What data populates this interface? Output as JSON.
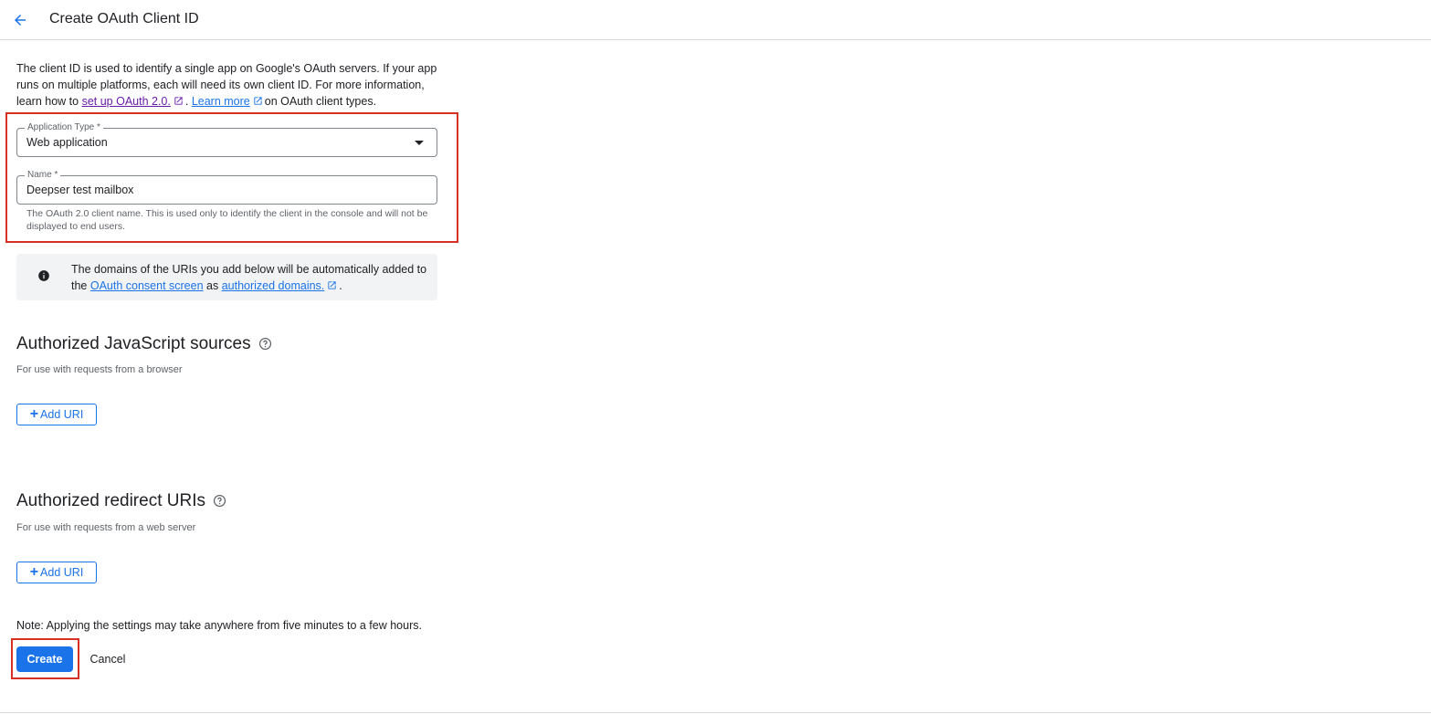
{
  "header": {
    "title": "Create OAuth Client ID",
    "back_icon": "arrow-back-icon"
  },
  "intro": {
    "text_1": "The client ID is used to identify a single app on Google's OAuth servers. If your app runs on multiple platforms, each will need its own client ID. For more information, learn how to ",
    "link_setup": "set up OAuth 2.0.",
    "text_2": ". ",
    "link_learn_more": "Learn more",
    "text_3": "on OAuth client types."
  },
  "form": {
    "application_type": {
      "label": "Application Type *",
      "value": "Web application"
    },
    "name": {
      "label": "Name *",
      "value": "Deepser test mailbox",
      "helper": "The OAuth 2.0 client name. This is used only to identify the client in the console and will not be displayed to end users."
    }
  },
  "info": {
    "text_1": "The domains of the URIs you add below will be automatically added to the ",
    "link_consent": "OAuth consent screen",
    "text_2": " as ",
    "link_domains": "authorized domains.",
    "text_3": "."
  },
  "js_sources": {
    "title": "Authorized JavaScript sources",
    "subtitle": "For use with requests from a browser",
    "add_label": "Add URI"
  },
  "redirect_uris": {
    "title": "Authorized redirect URIs",
    "subtitle": "For use with requests from a web server",
    "add_label": "Add URI"
  },
  "footer": {
    "note": "Note: Applying the settings may take anywhere from five minutes to a few hours.",
    "create_label": "Create",
    "cancel_label": "Cancel"
  },
  "colors": {
    "accent": "#1a73e8",
    "highlight": "#d93025",
    "visited_link": "#681da8",
    "info_bg": "#f1f3f4"
  }
}
